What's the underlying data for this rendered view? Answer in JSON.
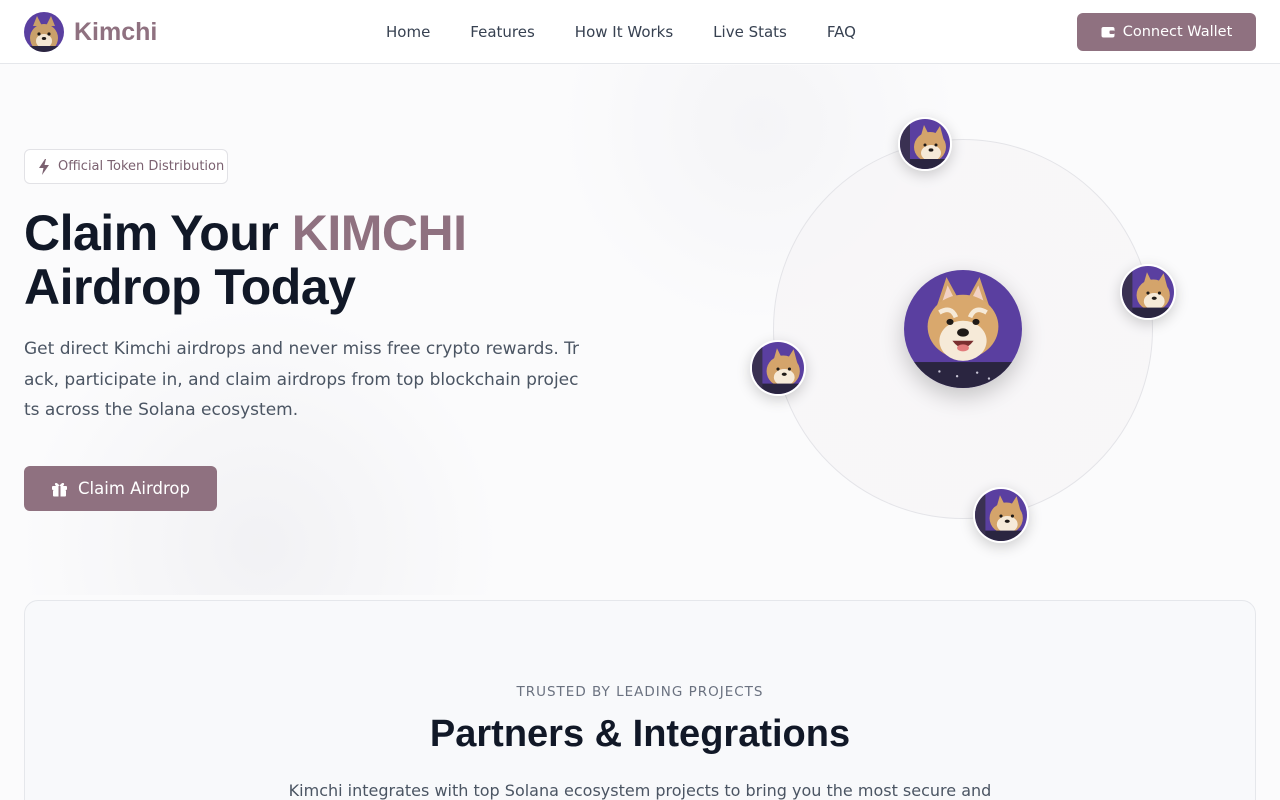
{
  "header": {
    "brand_name": "Kimchi",
    "nav": [
      "Home",
      "Features",
      "How It Works",
      "Live Stats",
      "FAQ"
    ],
    "connect_label": "Connect Wallet"
  },
  "hero": {
    "badge": "Official Token Distribution",
    "title_prefix": "Claim Your ",
    "title_accent": "KIMCHI",
    "title_suffix": "Airdrop Today",
    "description": "Get direct Kimchi airdrops and never miss free crypto rewards. Track, participate in, and claim airdrops from top blockchain projects across the Solana ecosystem.",
    "cta_label": "Claim Airdrop"
  },
  "partners": {
    "eyebrow": "TRUSTED BY LEADING PROJECTS",
    "title": "Partners & Integrations",
    "description": "Kimchi integrates with top Solana ecosystem projects to bring you the most secure and"
  },
  "colors": {
    "brand": "#8f7180",
    "text_dark": "#111827",
    "text_muted": "#4b5563",
    "avatar_bg": "#5a3fa0"
  },
  "icons": {
    "wallet": "wallet-icon",
    "bolt": "bolt-icon",
    "gift": "gift-icon",
    "mascot": "shiba-dog-avatar"
  }
}
